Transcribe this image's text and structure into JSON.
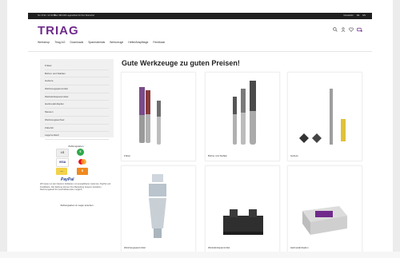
{
  "topbar": {
    "phone": "Tel. 0711 / 12 34 56",
    "promo": "Über 360.000 Lagerartikel für Ihre Wünsche!",
    "links": [
      "Newsletter",
      "DE",
      "EN"
    ]
  },
  "header": {
    "logo": "TRIAG",
    "nav": [
      "Werkshop",
      "Triag AG",
      "Downloads",
      "Sparmaterials",
      "Werkzeuge",
      "Hefte/Abspftiage",
      "Feedback"
    ],
    "icons": [
      "search-icon",
      "user-icon",
      "heart-icon",
      "cart-icon"
    ]
  },
  "sidebar": {
    "categories": [
      "Fräser",
      "Bohrer und Stahlen",
      "Gebeze",
      "Werkzeugspannmittel",
      "Werkstückspannmittel",
      "Hartmetall-Zapfen",
      "Messen",
      "Werkzeugwechsel",
      "Zubehör",
      "Lagerverkauf"
    ],
    "payment_title": "Zahlungsarten",
    "payment_logos": [
      {
        "name": "lastschrift",
        "text": "LS",
        "color": "#ffffff",
        "bg": "#e8e8e8",
        "fg": "#555555"
      },
      {
        "name": "bar",
        "text": "€",
        "bg": "#2ea84a",
        "fg": "#ffffff"
      },
      {
        "name": "visa",
        "text": "VISA",
        "bg": "#ffffff",
        "fg": "#1a1f71"
      },
      {
        "name": "mastercard",
        "text": "MC",
        "bg": "#f79e1b",
        "fg": "#eb001b"
      },
      {
        "name": "rechnung",
        "text": "—",
        "bg": "#f2d24a",
        "fg": "#555555"
      },
      {
        "name": "sofort",
        "text": "S",
        "bg": "#ef8a1f",
        "fg": "#ffffff"
      }
    ],
    "paypal": "PayPal",
    "payment_description": "Wir bieten an den Käufern Zahlarten mit auswahlbarer Lieferzeit, PayPal und Kreditkarte. Die Zahlung können Ihre Bestellung bequem bezahlen. Rechnungskauf für Geschäftskunden möglich.",
    "payment_link": "Zahlungsarten im Lager ansehen"
  },
  "main": {
    "heading": "Gute Werkzeuge zu guten Preisen!",
    "products": [
      {
        "label": "Fräser"
      },
      {
        "label": "Bohrer und Stahlen"
      },
      {
        "label": "Gebeze"
      },
      {
        "label": "Werkzeugspannmittel"
      },
      {
        "label": "Werkstückspannmittel"
      },
      {
        "label": "Hartmetall-Zapfen"
      }
    ]
  },
  "colors": {
    "brand": "#6f2a8c",
    "topbar": "#1f1f1f",
    "sidebar_bg": "#f0f0f0"
  }
}
